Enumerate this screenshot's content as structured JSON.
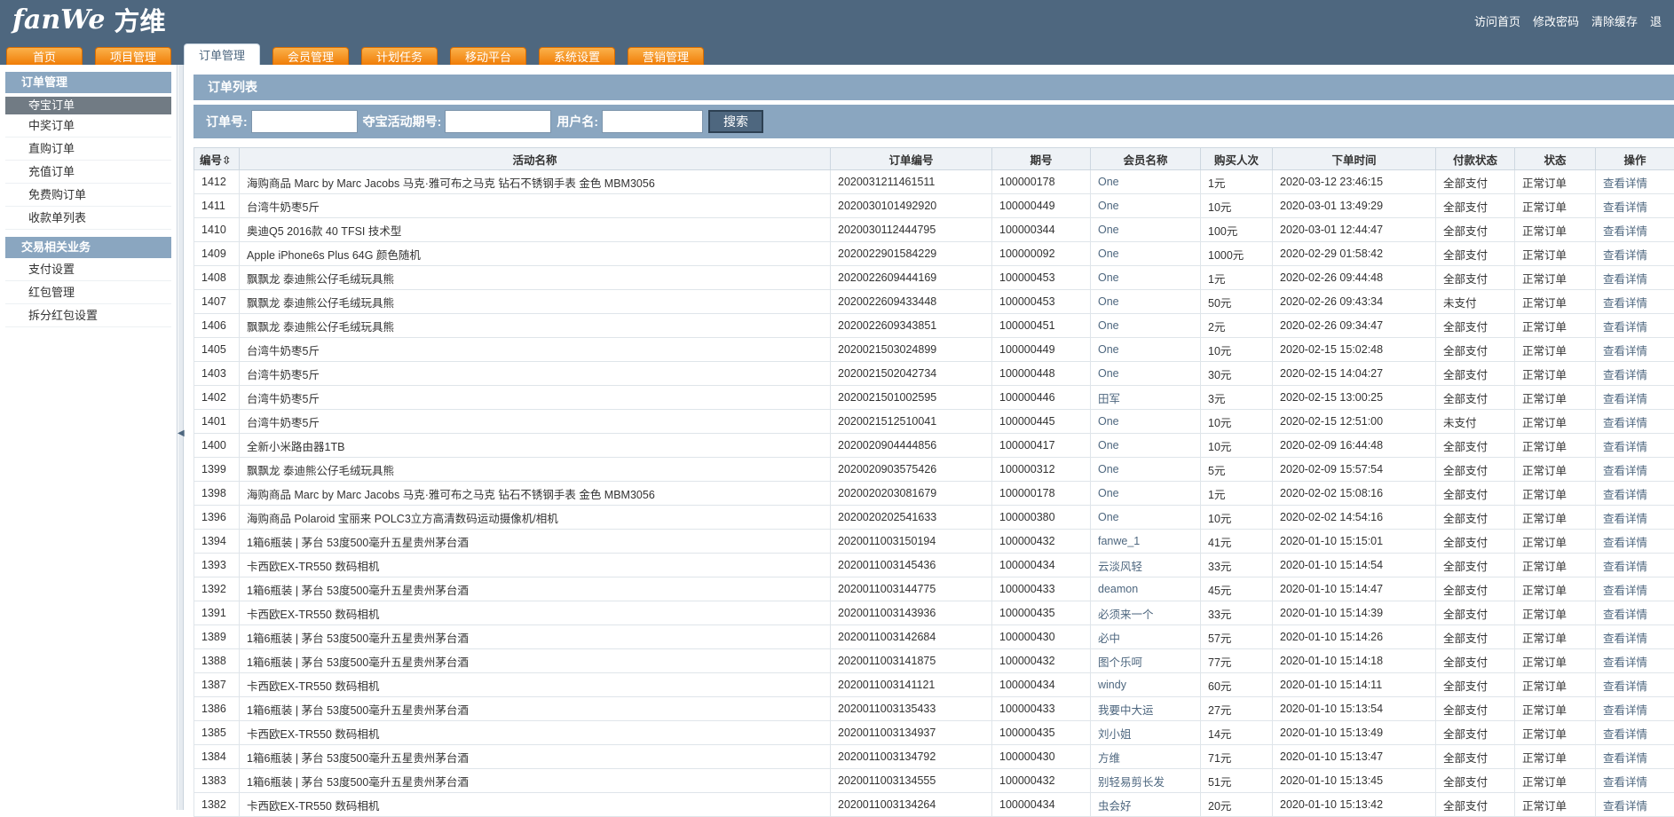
{
  "header": {
    "logo_en": "fanWe",
    "logo_cn": "方维",
    "links": [
      "访问首页",
      "修改密码",
      "清除缓存",
      "退"
    ]
  },
  "nav": {
    "tabs": [
      "首页",
      "项目管理",
      "订单管理",
      "会员管理",
      "计划任务",
      "移动平台",
      "系统设置",
      "营销管理"
    ],
    "active_index": 2
  },
  "sidebar": {
    "groups": [
      {
        "title": "订单管理",
        "items": [
          "夺宝订单",
          "中奖订单",
          "直购订单",
          "充值订单",
          "免费购订单",
          "收款单列表"
        ]
      },
      {
        "title": "交易相关业务",
        "items": [
          "支付设置",
          "红包管理",
          "拆分红包设置"
        ]
      }
    ],
    "active_item": "夺宝订单"
  },
  "splitter_arrow": "◀",
  "page_title": "订单列表",
  "search": {
    "order_no_label": "订单号:",
    "period_label": "夺宝活动期号:",
    "username_label": "用户名:",
    "button_label": "搜索"
  },
  "table": {
    "columns": [
      "编号⇳",
      "活动名称",
      "订单编号",
      "期号",
      "会员名称",
      "购买人次",
      "下单时间",
      "付款状态",
      "状态",
      "操作"
    ],
    "rows": [
      [
        "1412",
        "海购商品 Marc by Marc Jacobs 马克·雅可布之马克 钻石不锈钢手表 金色 MBM3056",
        "2020031211461511",
        "100000178",
        "One",
        "1元",
        "2020-03-12 23:46:15",
        "全部支付",
        "正常订单",
        "查看详情"
      ],
      [
        "1411",
        "台湾牛奶枣5斤",
        "2020030101492920",
        "100000449",
        "One",
        "10元",
        "2020-03-01 13:49:29",
        "全部支付",
        "正常订单",
        "查看详情"
      ],
      [
        "1410",
        "奥迪Q5 2016款 40 TFSI 技术型",
        "2020030112444795",
        "100000344",
        "One",
        "100元",
        "2020-03-01 12:44:47",
        "全部支付",
        "正常订单",
        "查看详情"
      ],
      [
        "1409",
        "Apple iPhone6s Plus 64G 颜色随机",
        "2020022901584229",
        "100000092",
        "One",
        "1000元",
        "2020-02-29 01:58:42",
        "全部支付",
        "正常订单",
        "查看详情"
      ],
      [
        "1408",
        "飘飘龙 泰迪熊公仔毛绒玩具熊",
        "2020022609444169",
        "100000453",
        "One",
        "1元",
        "2020-02-26 09:44:48",
        "全部支付",
        "正常订单",
        "查看详情"
      ],
      [
        "1407",
        "飘飘龙 泰迪熊公仔毛绒玩具熊",
        "2020022609433448",
        "100000453",
        "One",
        "50元",
        "2020-02-26 09:43:34",
        "未支付",
        "正常订单",
        "查看详情"
      ],
      [
        "1406",
        "飘飘龙 泰迪熊公仔毛绒玩具熊",
        "2020022609343851",
        "100000451",
        "One",
        "2元",
        "2020-02-26 09:34:47",
        "全部支付",
        "正常订单",
        "查看详情"
      ],
      [
        "1405",
        "台湾牛奶枣5斤",
        "2020021503024899",
        "100000449",
        "One",
        "10元",
        "2020-02-15 15:02:48",
        "全部支付",
        "正常订单",
        "查看详情"
      ],
      [
        "1403",
        "台湾牛奶枣5斤",
        "2020021502042734",
        "100000448",
        "One",
        "30元",
        "2020-02-15 14:04:27",
        "全部支付",
        "正常订单",
        "查看详情"
      ],
      [
        "1402",
        "台湾牛奶枣5斤",
        "2020021501002595",
        "100000446",
        "田军",
        "3元",
        "2020-02-15 13:00:25",
        "全部支付",
        "正常订单",
        "查看详情"
      ],
      [
        "1401",
        "台湾牛奶枣5斤",
        "2020021512510041",
        "100000445",
        "One",
        "10元",
        "2020-02-15 12:51:00",
        "未支付",
        "正常订单",
        "查看详情"
      ],
      [
        "1400",
        "全新小米路由器1TB",
        "2020020904444856",
        "100000417",
        "One",
        "10元",
        "2020-02-09 16:44:48",
        "全部支付",
        "正常订单",
        "查看详情"
      ],
      [
        "1399",
        "飘飘龙 泰迪熊公仔毛绒玩具熊",
        "2020020903575426",
        "100000312",
        "One",
        "5元",
        "2020-02-09 15:57:54",
        "全部支付",
        "正常订单",
        "查看详情"
      ],
      [
        "1398",
        "海购商品 Marc by Marc Jacobs 马克·雅可布之马克 钻石不锈钢手表 金色 MBM3056",
        "2020020203081679",
        "100000178",
        "One",
        "1元",
        "2020-02-02 15:08:16",
        "全部支付",
        "正常订单",
        "查看详情"
      ],
      [
        "1396",
        "海购商品 Polaroid 宝丽来 POLC3立方高清数码运动摄像机/相机",
        "2020020202541633",
        "100000380",
        "One",
        "10元",
        "2020-02-02 14:54:16",
        "全部支付",
        "正常订单",
        "查看详情"
      ],
      [
        "1394",
        "1箱6瓶装 | 茅台 53度500毫升五星贵州茅台酒",
        "2020011003150194",
        "100000432",
        "fanwe_1",
        "41元",
        "2020-01-10 15:15:01",
        "全部支付",
        "正常订单",
        "查看详情"
      ],
      [
        "1393",
        "卡西欧EX-TR550 数码相机",
        "2020011003145436",
        "100000434",
        "云淡风轻",
        "33元",
        "2020-01-10 15:14:54",
        "全部支付",
        "正常订单",
        "查看详情"
      ],
      [
        "1392",
        "1箱6瓶装 | 茅台 53度500毫升五星贵州茅台酒",
        "2020011003144775",
        "100000433",
        "deamon",
        "45元",
        "2020-01-10 15:14:47",
        "全部支付",
        "正常订单",
        "查看详情"
      ],
      [
        "1391",
        "卡西欧EX-TR550 数码相机",
        "2020011003143936",
        "100000435",
        "必须来一个",
        "33元",
        "2020-01-10 15:14:39",
        "全部支付",
        "正常订单",
        "查看详情"
      ],
      [
        "1389",
        "1箱6瓶装 | 茅台 53度500毫升五星贵州茅台酒",
        "2020011003142684",
        "100000430",
        "必中",
        "57元",
        "2020-01-10 15:14:26",
        "全部支付",
        "正常订单",
        "查看详情"
      ],
      [
        "1388",
        "1箱6瓶装 | 茅台 53度500毫升五星贵州茅台酒",
        "2020011003141875",
        "100000432",
        "图个乐呵",
        "77元",
        "2020-01-10 15:14:18",
        "全部支付",
        "正常订单",
        "查看详情"
      ],
      [
        "1387",
        "卡西欧EX-TR550 数码相机",
        "2020011003141121",
        "100000434",
        "windy",
        "60元",
        "2020-01-10 15:14:11",
        "全部支付",
        "正常订单",
        "查看详情"
      ],
      [
        "1386",
        "1箱6瓶装 | 茅台 53度500毫升五星贵州茅台酒",
        "2020011003135433",
        "100000433",
        "我要中大运",
        "27元",
        "2020-01-10 15:13:54",
        "全部支付",
        "正常订单",
        "查看详情"
      ],
      [
        "1385",
        "卡西欧EX-TR550 数码相机",
        "2020011003134937",
        "100000435",
        "刘小姐",
        "14元",
        "2020-01-10 15:13:49",
        "全部支付",
        "正常订单",
        "查看详情"
      ],
      [
        "1384",
        "1箱6瓶装 | 茅台 53度500毫升五星贵州茅台酒",
        "2020011003134792",
        "100000430",
        "方维",
        "71元",
        "2020-01-10 15:13:47",
        "全部支付",
        "正常订单",
        "查看详情"
      ],
      [
        "1383",
        "1箱6瓶装 | 茅台 53度500毫升五星贵州茅台酒",
        "2020011003134555",
        "100000432",
        "别轻易剪长发",
        "51元",
        "2020-01-10 15:13:45",
        "全部支付",
        "正常订单",
        "查看详情"
      ],
      [
        "1382",
        "卡西欧EX-TR550 数码相机",
        "2020011003134264",
        "100000434",
        "虫会好",
        "20元",
        "2020-01-10 15:13:42",
        "全部支付",
        "正常订单",
        "查看详情"
      ]
    ]
  }
}
